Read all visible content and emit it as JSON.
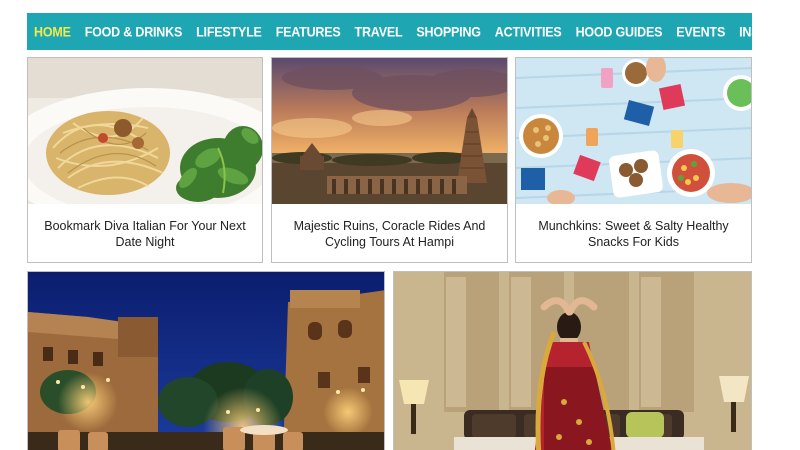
{
  "nav": {
    "items": [
      {
        "label": "HOME",
        "active": true
      },
      {
        "label": "FOOD & DRINKS",
        "active": false
      },
      {
        "label": "LIFESTYLE",
        "active": false
      },
      {
        "label": "FEATURES",
        "active": false
      },
      {
        "label": "TRAVEL",
        "active": false
      },
      {
        "label": "SHOPPING",
        "active": false
      },
      {
        "label": "ACTIVITIES",
        "active": false
      },
      {
        "label": "HOOD GUIDES",
        "active": false
      },
      {
        "label": "EVENTS",
        "active": false
      },
      {
        "label": "INSIDERS",
        "active": false
      }
    ],
    "search_icon": "search-icon"
  },
  "cards": [
    {
      "title": "Bookmark Diva Italian For Your Next Date Night",
      "image": "pasta-plate"
    },
    {
      "title": "Majestic Ruins, Coracle Rides And Cycling Tours At Hampi",
      "image": "hampi-temple-sunset"
    },
    {
      "title": "Munchkins: Sweet & Salty Healthy Snacks For Kids",
      "image": "snacks-table"
    }
  ],
  "features": [
    {
      "image": "palace-courtyard-night"
    },
    {
      "image": "woman-in-saree-bedroom"
    }
  ],
  "colors": {
    "nav_bg": "#1ea7b3",
    "nav_active": "#f2ea4b",
    "search_bg": "#1f1f1f"
  }
}
